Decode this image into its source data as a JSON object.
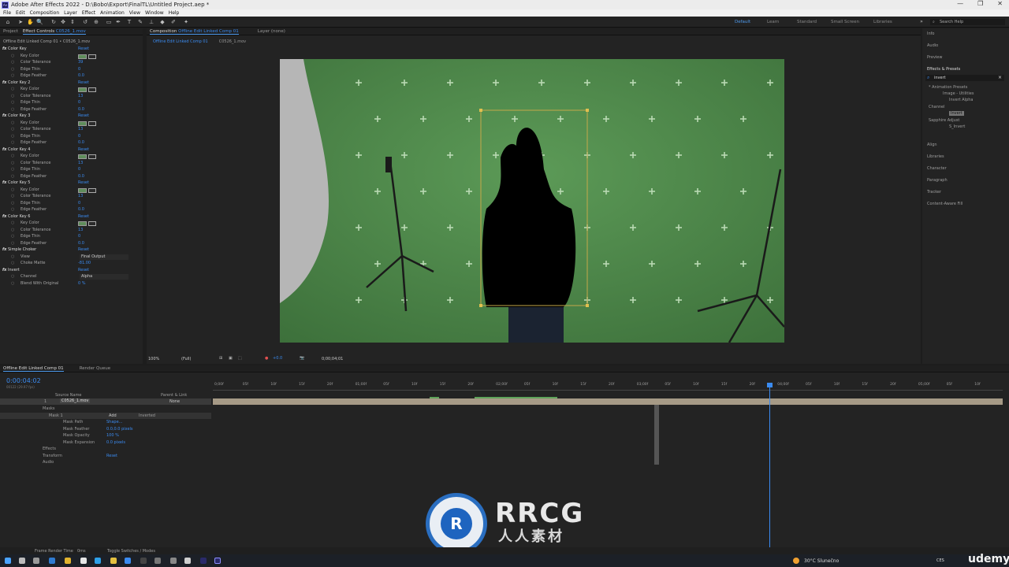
{
  "window": {
    "title": "Adobe After Effects 2022 - D:\\Bobo\\Export\\FinalTL\\Untitled Project.aep *",
    "controls": [
      "—",
      "❐",
      "✕"
    ]
  },
  "menu": [
    "File",
    "Edit",
    "Composition",
    "Layer",
    "Effect",
    "Animation",
    "View",
    "Window",
    "Help"
  ],
  "workspaces": [
    "Default",
    "Learn",
    "Standard",
    "Small Screen",
    "Libraries"
  ],
  "search_help": "Search Help",
  "left_panel": {
    "tabs": [
      "Project",
      "Effect Controls",
      "C0526_1.mov"
    ],
    "breadcrumb": "Offline Edit Linked Comp 01 • C0526_1.mov",
    "effects": [
      {
        "name": "Color Key",
        "reset": "Reset",
        "props": [
          [
            "Key Color",
            ""
          ],
          [
            "Color Tolerance",
            "39"
          ],
          [
            "Edge Thin",
            "0"
          ],
          [
            "Edge Feather",
            "0.0"
          ]
        ]
      },
      {
        "name": "Color Key 2",
        "reset": "Reset",
        "props": [
          [
            "Key Color",
            ""
          ],
          [
            "Color Tolerance",
            "13"
          ],
          [
            "Edge Thin",
            "0"
          ],
          [
            "Edge Feather",
            "0.0"
          ]
        ]
      },
      {
        "name": "Color Key 3",
        "reset": "Reset",
        "props": [
          [
            "Key Color",
            ""
          ],
          [
            "Color Tolerance",
            "13"
          ],
          [
            "Edge Thin",
            "0"
          ],
          [
            "Edge Feather",
            "0.0"
          ]
        ]
      },
      {
        "name": "Color Key 4",
        "reset": "Reset",
        "props": [
          [
            "Key Color",
            ""
          ],
          [
            "Color Tolerance",
            "13"
          ],
          [
            "Edge Thin",
            "0"
          ],
          [
            "Edge Feather",
            "0.0"
          ]
        ]
      },
      {
        "name": "Color Key 5",
        "reset": "Reset",
        "props": [
          [
            "Key Color",
            ""
          ],
          [
            "Color Tolerance",
            "13"
          ],
          [
            "Edge Thin",
            "0"
          ],
          [
            "Edge Feather",
            "0.0"
          ]
        ]
      },
      {
        "name": "Color Key 6",
        "reset": "Reset",
        "props": [
          [
            "Key Color",
            ""
          ],
          [
            "Color Tolerance",
            "13"
          ],
          [
            "Edge Thin",
            "0"
          ],
          [
            "Edge Feather",
            "0.0"
          ]
        ]
      }
    ],
    "simple_choker": {
      "name": "Simple Choker",
      "reset": "Reset",
      "view_label": "View",
      "view_value": "Final Output",
      "choke_label": "Choke Matte",
      "choke_value": "-81.00"
    },
    "invert": {
      "name": "Invert",
      "reset": "Reset",
      "channel_label": "Channel",
      "channel_value": "Alpha",
      "blend_label": "Blend With Original",
      "blend_value": "0 %"
    }
  },
  "comp_panel": {
    "tab": "Composition",
    "comp_name": "Offline Edit Linked Comp 01",
    "layer_label": "Layer (none)",
    "subtabs": [
      "Offline Edit Linked Comp 01",
      "C0526_1.mov"
    ],
    "zoom": "100%",
    "resolution": "(Full)",
    "exposure": "+0.0",
    "timecode": "0;00;04;01"
  },
  "right_panel": {
    "items_top": [
      "Info",
      "Audio",
      "Preview"
    ],
    "effects_presets": {
      "title": "Effects & Presets",
      "search": "invert",
      "tree": [
        "* Animation Presets",
        "Image - Utilities",
        "Invert Alpha",
        "Channel",
        "Invert",
        "Sapphire Adjust",
        "S_Invert"
      ]
    },
    "items_bottom": [
      "Align",
      "Libraries",
      "Character",
      "Paragraph",
      "Tracker",
      "Content-Aware Fill"
    ]
  },
  "timeline": {
    "tabs": [
      "Offline Edit Linked Comp 01",
      "Render Queue"
    ],
    "timecode": "0:00:04:02",
    "fps": "00122 (29.97 fps)",
    "headers": [
      "Source Name",
      "Parent & Link"
    ],
    "layer": {
      "index": "1",
      "name": "C0526_1.mov",
      "parent": "None"
    },
    "props": [
      {
        "name": "Masks"
      },
      {
        "name": "Mask 1",
        "mode": "Add",
        "inverted": "Inverted"
      },
      {
        "name": "Mask Path",
        "value": "Shape..."
      },
      {
        "name": "Mask Feather",
        "value": "0.0,0.0 pixels"
      },
      {
        "name": "Mask Opacity",
        "value": "100 %"
      },
      {
        "name": "Mask Expansion",
        "value": "0.0 pixels"
      },
      {
        "name": "Effects"
      },
      {
        "name": "Transform",
        "value": "Reset"
      },
      {
        "name": "Audio"
      }
    ],
    "ruler": [
      "0;00f",
      "05f",
      "10f",
      "15f",
      "20f",
      "01;00f",
      "05f",
      "10f",
      "15f",
      "20f",
      "02;00f",
      "05f",
      "10f",
      "15f",
      "20f",
      "03;00f",
      "05f",
      "10f",
      "15f",
      "20f",
      "04;00f",
      "05f",
      "10f",
      "15f",
      "20f",
      "05;00f",
      "05f",
      "10f"
    ],
    "footer": [
      "Frame Render Time",
      "0ms",
      "Toggle Switches / Modes"
    ]
  },
  "watermark": {
    "brand": "RRCG",
    "sub": "人人素材"
  },
  "udemy": "udemy",
  "taskbar": {
    "weather": "30°C  Slunečno",
    "lang": "CES"
  },
  "colors": {
    "accent": "#3b8bf0",
    "green_screen": "#4d8a4a",
    "layer_bar": "#a69a86"
  }
}
